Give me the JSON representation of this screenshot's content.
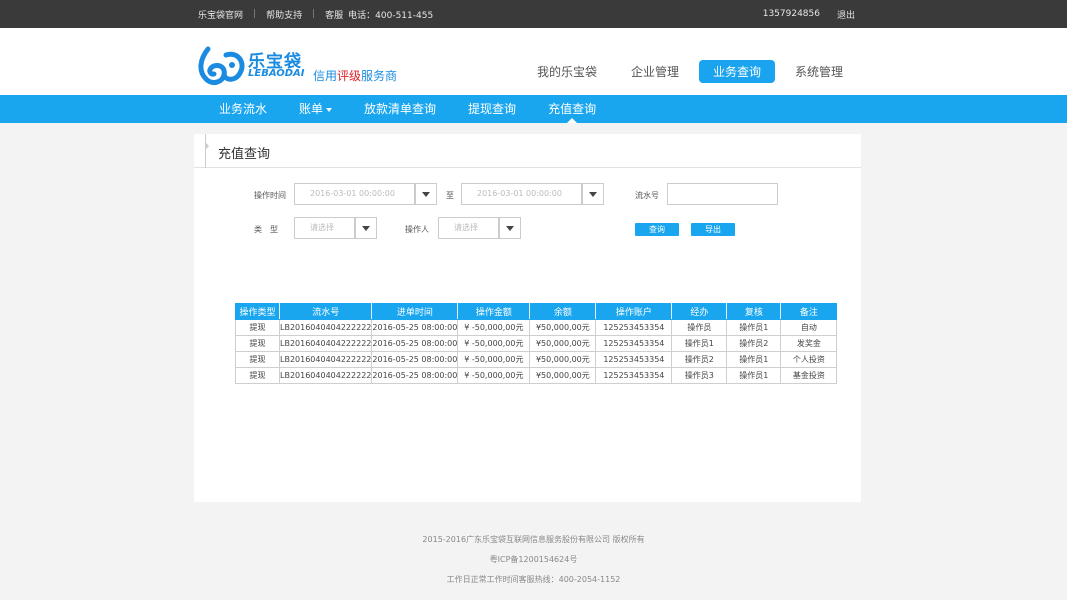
{
  "topbar": {
    "links": [
      "乐宝袋官网",
      "帮助支持",
      "客服"
    ],
    "phone_label": "电话：400-511-455",
    "account": "1357924856",
    "logout": "退出"
  },
  "logo": {
    "name": "乐宝袋",
    "en": "LEBAODAI",
    "slogan_a": "信用",
    "slogan_hl": "评级",
    "slogan_b": "服务商"
  },
  "main_nav": [
    "我的乐宝袋",
    "企业管理",
    "业务查询",
    "系统管理"
  ],
  "sub_nav": {
    "items": [
      "业务流水",
      "账单",
      "放款清单查询",
      "提现查询",
      "充值查询"
    ]
  },
  "panel": {
    "title": "充值查询"
  },
  "filters": {
    "op_time_label": "操作时间",
    "date_from": "2016-03-01  00:00:00",
    "to_label": "至",
    "date_to": "2016-03-01  00:00:00",
    "serial_label": "流水号",
    "serial_value": "",
    "type_label": "类　型",
    "type_placeholder": "请选择",
    "operator_label": "操作人",
    "operator_placeholder": "请选择",
    "query_btn": "查询",
    "export_btn": "导出"
  },
  "table": {
    "columns": [
      "操作类型",
      "流水号",
      "进单时间",
      "操作金额",
      "余额",
      "操作账户",
      "经办",
      "复核",
      "备注"
    ],
    "rows": [
      [
        "提现",
        "LB2016040404222222",
        "2016-05-25 08:00:00",
        "¥ -50,000,00元",
        "¥50,000,00元",
        "125253453354",
        "操作员",
        "操作员1",
        "自动"
      ],
      [
        "提现",
        "LB2016040404222222",
        "2016-05-25 08:00:00",
        "¥ -50,000,00元",
        "¥50,000,00元",
        "125253453354",
        "操作员1",
        "操作员2",
        "发奖金"
      ],
      [
        "提现",
        "LB2016040404222222",
        "2016-05-25 08:00:00",
        "¥ -50,000,00元",
        "¥50,000,00元",
        "125253453354",
        "操作员2",
        "操作员1",
        "个人投资"
      ],
      [
        "提现",
        "LB2016040404222222",
        "2016-05-25 08:00:00",
        "¥ -50,000,00元",
        "¥50,000,00元",
        "125253453354",
        "操作员3",
        "操作员1",
        "基金投资"
      ]
    ]
  },
  "footer": {
    "copyright": "2015-2016广东乐宝袋互联网信息服务股份有限公司 版权所有",
    "icp": "粤ICP备1200154624号",
    "hotline": "工作日正常工作时间客服热线：400-2054-1152"
  },
  "colors": {
    "accent": "#1aa6ef",
    "topbar_bg": "#3a3a3a",
    "slogan_highlight": "#e0242b"
  }
}
